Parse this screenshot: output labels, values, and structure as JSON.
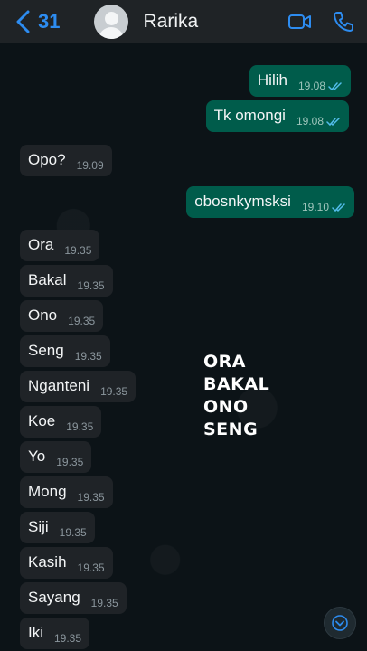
{
  "header": {
    "back_count": "31",
    "contact_name": "Rarika"
  },
  "overlay": [
    "ORA",
    "BAKAL",
    "ONO",
    "SENG"
  ],
  "messages": [
    {
      "text": "Hilih",
      "time": "19.08",
      "dir": "out"
    },
    {
      "text": "Tk omongi",
      "time": "19.08",
      "dir": "out"
    },
    {
      "text": "Opo?",
      "time": "19.09",
      "dir": "in"
    },
    {
      "text": "obosnkymsksi",
      "time": "19.10",
      "dir": "out"
    },
    {
      "text": "Ora",
      "time": "19.35",
      "dir": "in"
    },
    {
      "text": "Bakal",
      "time": "19.35",
      "dir": "in"
    },
    {
      "text": "Ono",
      "time": "19.35",
      "dir": "in"
    },
    {
      "text": "Seng",
      "time": "19.35",
      "dir": "in"
    },
    {
      "text": "Nganteni",
      "time": "19.35",
      "dir": "in"
    },
    {
      "text": "Koe",
      "time": "19.35",
      "dir": "in"
    },
    {
      "text": "Yo",
      "time": "19.35",
      "dir": "in"
    },
    {
      "text": "Mong",
      "time": "19.35",
      "dir": "in"
    },
    {
      "text": "Siji",
      "time": "19.35",
      "dir": "in"
    },
    {
      "text": "Kasih",
      "time": "19.35",
      "dir": "in"
    },
    {
      "text": "Sayang",
      "time": "19.35",
      "dir": "in"
    },
    {
      "text": "Iki",
      "time": "19.35",
      "dir": "in"
    }
  ],
  "colors": {
    "accent": "#2d8cf0",
    "outgoing_bubble": "#005c4b",
    "incoming_bubble": "#1f2327",
    "read_ticks": "#53bdeb"
  },
  "icons": [
    "chevron-left-icon",
    "avatar-icon",
    "video-call-icon",
    "phone-icon",
    "double-check-icon",
    "scroll-down-icon"
  ]
}
